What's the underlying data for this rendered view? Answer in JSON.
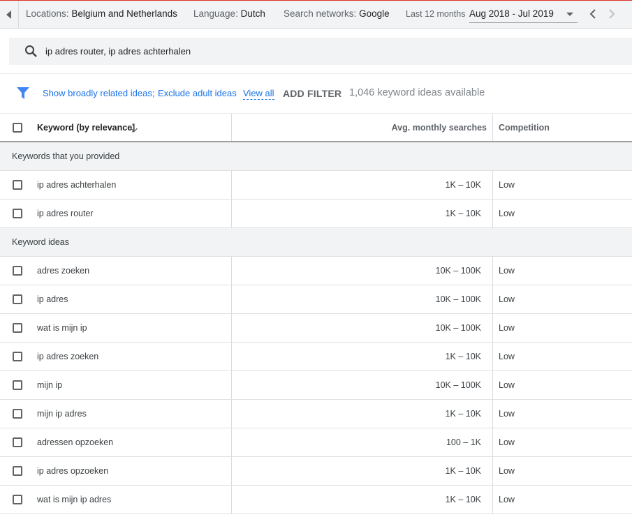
{
  "topbar": {
    "locations_label": "Locations:",
    "locations_value": "Belgium and Netherlands",
    "language_label": "Language:",
    "language_value": "Dutch",
    "networks_label": "Search networks:",
    "networks_value": "Google",
    "period_label": "Last 12 months",
    "date_range": "Aug 2018 - Jul 2019"
  },
  "search": {
    "value": "ip adres router, ip adres achterhalen"
  },
  "filters": {
    "related_ideas": "Show broadly related ideas;",
    "exclude_adult": "Exclude adult ideas",
    "view_all": "View all",
    "add_filter": "ADD FILTER",
    "ideas_count": "1,046 keyword ideas available"
  },
  "table": {
    "headers": {
      "keyword": "Keyword (by relevance)",
      "avg_searches": "Avg. monthly searches",
      "competition": "Competition"
    },
    "provided_section": "Keywords that you provided",
    "provided": [
      {
        "keyword": "ip adres achterhalen",
        "avg": "1K – 10K",
        "competition": "Low"
      },
      {
        "keyword": "ip adres router",
        "avg": "1K – 10K",
        "competition": "Low"
      }
    ],
    "ideas_section": "Keyword ideas",
    "ideas": [
      {
        "keyword": "adres zoeken",
        "avg": "10K – 100K",
        "competition": "Low"
      },
      {
        "keyword": "ip adres",
        "avg": "10K – 100K",
        "competition": "Low"
      },
      {
        "keyword": "wat is mijn ip",
        "avg": "10K – 100K",
        "competition": "Low"
      },
      {
        "keyword": "ip adres zoeken",
        "avg": "1K – 10K",
        "competition": "Low"
      },
      {
        "keyword": "mijn ip",
        "avg": "10K – 100K",
        "competition": "Low"
      },
      {
        "keyword": "mijn ip adres",
        "avg": "1K – 10K",
        "competition": "Low"
      },
      {
        "keyword": "adressen opzoeken",
        "avg": "100 – 1K",
        "competition": "Low"
      },
      {
        "keyword": "ip adres opzoeken",
        "avg": "1K – 10K",
        "competition": "Low"
      },
      {
        "keyword": "wat is mijn ip adres",
        "avg": "1K – 10K",
        "competition": "Low"
      }
    ]
  },
  "colors": {
    "link": "#1a73e8",
    "accent_red": "#d93025",
    "filter_icon": "#4285f4"
  },
  "icons": [
    "back-caret-icon",
    "dropdown-caret-icon",
    "chevron-left-icon",
    "chevron-right-icon",
    "search-icon",
    "filter-funnel-icon",
    "sort-arrow-down-icon"
  ]
}
